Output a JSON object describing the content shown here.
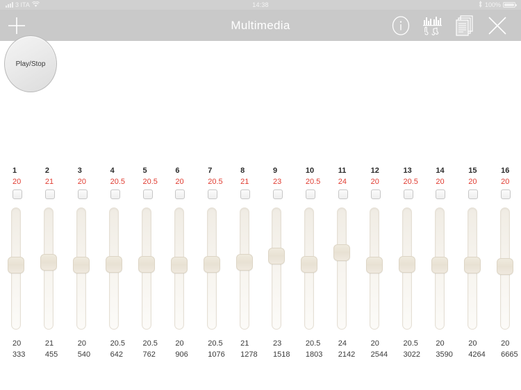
{
  "status_bar": {
    "carrier": "3 ITA",
    "wifi_icon": "wifi-icon",
    "signal_icon": "signal-bars-icon",
    "time": "14:38",
    "bluetooth_icon": "bluetooth-icon",
    "battery_percent": "100%",
    "battery_icon": "battery-full-icon"
  },
  "navbar": {
    "add_icon": "plus-icon",
    "title": "Multimedia",
    "info_icon": "info-circle-icon",
    "music_chart_icon": "music-spectrum-icon",
    "pages_icon": "document-stack-icon",
    "close_icon": "close-x-icon"
  },
  "transport": {
    "play_stop_label": "Play/Stop"
  },
  "colors": {
    "value_red": "#e03c31",
    "navbar_gray": "#c9c9c9",
    "statusbar_gray": "#d0d0d0",
    "slider_cream": "#efe9de"
  },
  "channels": [
    {
      "number": "1",
      "value": "20",
      "bottom_value": "20",
      "frequency": "333",
      "slider_pct": 47
    },
    {
      "number": "2",
      "value": "21",
      "bottom_value": "21",
      "frequency": "455",
      "slider_pct": 44
    },
    {
      "number": "3",
      "value": "20",
      "bottom_value": "20",
      "frequency": "540",
      "slider_pct": 47
    },
    {
      "number": "4",
      "value": "20.5",
      "bottom_value": "20.5",
      "frequency": "642",
      "slider_pct": 46
    },
    {
      "number": "5",
      "value": "20.5",
      "bottom_value": "20.5",
      "frequency": "762",
      "slider_pct": 46
    },
    {
      "number": "6",
      "value": "20",
      "bottom_value": "20",
      "frequency": "906",
      "slider_pct": 47
    },
    {
      "number": "7",
      "value": "20.5",
      "bottom_value": "20.5",
      "frequency": "1076",
      "slider_pct": 46
    },
    {
      "number": "8",
      "value": "21",
      "bottom_value": "21",
      "frequency": "1278",
      "slider_pct": 44
    },
    {
      "number": "9",
      "value": "23",
      "bottom_value": "23",
      "frequency": "1518",
      "slider_pct": 38
    },
    {
      "number": "10",
      "value": "20.5",
      "bottom_value": "20.5",
      "frequency": "1803",
      "slider_pct": 46
    },
    {
      "number": "11",
      "value": "24",
      "bottom_value": "24",
      "frequency": "2142",
      "slider_pct": 35
    },
    {
      "number": "12",
      "value": "20",
      "bottom_value": "20",
      "frequency": "2544",
      "slider_pct": 47
    },
    {
      "number": "13",
      "value": "20.5",
      "bottom_value": "20.5",
      "frequency": "3022",
      "slider_pct": 46
    },
    {
      "number": "14",
      "value": "20",
      "bottom_value": "20",
      "frequency": "3590",
      "slider_pct": 47
    },
    {
      "number": "15",
      "value": "20",
      "bottom_value": "20",
      "frequency": "4264",
      "slider_pct": 47
    },
    {
      "number": "16",
      "value": "20",
      "bottom_value": "20",
      "frequency": "6665",
      "slider_pct": 48
    }
  ]
}
